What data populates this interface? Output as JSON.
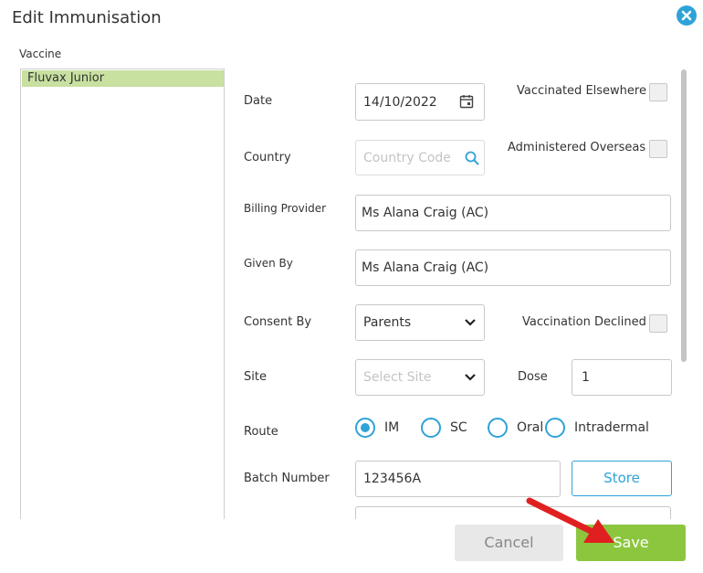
{
  "dialog": {
    "title": "Edit Immunisation"
  },
  "vaccine": {
    "label": "Vaccine",
    "items": [
      "Fluvax Junior"
    ]
  },
  "form": {
    "date": {
      "label": "Date",
      "value": "14/10/2022"
    },
    "vaccinated_elsewhere": {
      "label": "Vaccinated Elsewhere",
      "checked": false
    },
    "country": {
      "label": "Country",
      "placeholder": "Country Code"
    },
    "administered_overseas": {
      "label": "Administered Overseas",
      "checked": false
    },
    "billing_provider": {
      "label": "Billing Provider",
      "value": "Ms Alana Craig (AC)"
    },
    "given_by": {
      "label": "Given By",
      "value": "Ms Alana Craig (AC)"
    },
    "consent_by": {
      "label": "Consent By",
      "value": "Parents"
    },
    "vaccination_declined": {
      "label": "Vaccination Declined",
      "checked": false
    },
    "site": {
      "label": "Site",
      "placeholder": "Select Site"
    },
    "dose": {
      "label": "Dose",
      "value": "1"
    },
    "route": {
      "label": "Route",
      "options": [
        "IM",
        "SC",
        "Oral",
        "Intradermal"
      ],
      "selected": "IM"
    },
    "batch_number": {
      "label": "Batch Number",
      "value": "123456A",
      "store_label": "Store"
    }
  },
  "footer": {
    "cancel_label": "Cancel",
    "save_label": "Save"
  },
  "colors": {
    "accent": "#2ea3d8",
    "save": "#8cc63f",
    "selected_item": "#c8e0a0",
    "annotation_arrow": "#e02020"
  }
}
